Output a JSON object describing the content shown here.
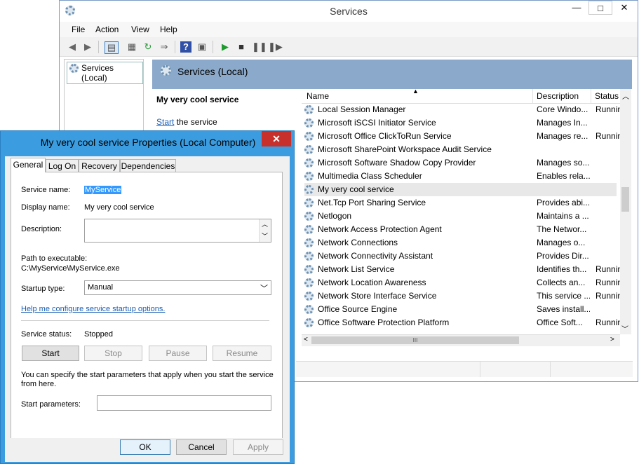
{
  "services_window": {
    "title": "Services",
    "controls": {
      "minimize": "—",
      "maximize": "□",
      "close": "✕"
    },
    "menu": [
      "File",
      "Action",
      "View",
      "Help"
    ],
    "tree_item": "Services (Local)",
    "header_title": "Services (Local)",
    "detail": {
      "service_name": "My very cool service",
      "start_link": "Start",
      "start_suffix": " the service"
    },
    "columns": {
      "name": "Name",
      "description": "Description",
      "status": "Status"
    },
    "rows": [
      {
        "name": "Local Session Manager",
        "description": "Core Windo...",
        "status": "Runnin"
      },
      {
        "name": "Microsoft iSCSI Initiator Service",
        "description": "Manages In...",
        "status": ""
      },
      {
        "name": "Microsoft Office ClickToRun Service",
        "description": "Manages re...",
        "status": "Runnin"
      },
      {
        "name": "Microsoft SharePoint Workspace Audit Service",
        "description": "",
        "status": ""
      },
      {
        "name": "Microsoft Software Shadow Copy Provider",
        "description": "Manages so...",
        "status": ""
      },
      {
        "name": "Multimedia Class Scheduler",
        "description": "Enables rela...",
        "status": ""
      },
      {
        "name": "My very cool service",
        "description": "",
        "status": ""
      },
      {
        "name": "Net.Tcp Port Sharing Service",
        "description": "Provides abi...",
        "status": ""
      },
      {
        "name": "Netlogon",
        "description": "Maintains a ...",
        "status": ""
      },
      {
        "name": "Network Access Protection Agent",
        "description": "The Networ...",
        "status": ""
      },
      {
        "name": "Network Connections",
        "description": "Manages o...",
        "status": ""
      },
      {
        "name": "Network Connectivity Assistant",
        "description": "Provides Dir...",
        "status": ""
      },
      {
        "name": "Network List Service",
        "description": "Identifies th...",
        "status": "Runnin"
      },
      {
        "name": "Network Location Awareness",
        "description": "Collects an...",
        "status": "Runnin"
      },
      {
        "name": "Network Store Interface Service",
        "description": "This service ...",
        "status": "Runnin"
      },
      {
        "name": "Office  Source Engine",
        "description": "Saves install...",
        "status": ""
      },
      {
        "name": "Office Software Protection Platform",
        "description": "Office Soft...",
        "status": "Runnin"
      }
    ],
    "hscroll_grip": "III"
  },
  "dialog": {
    "title": "My very cool service Properties (Local Computer)",
    "close": "✕",
    "tabs": [
      "General",
      "Log On",
      "Recovery",
      "Dependencies"
    ],
    "service_name_label": "Service name:",
    "service_name_value": "MyService",
    "display_name_label": "Display name:",
    "display_name_value": "My very cool service",
    "description_label": "Description:",
    "path_label": "Path to executable:",
    "path_value": "C:\\MyService\\MyService.exe",
    "startup_type_label": "Startup type:",
    "startup_type_value": "Manual",
    "help_link": "Help me configure service startup options.",
    "status_label": "Service status:",
    "status_value": "Stopped",
    "buttons": {
      "start": "Start",
      "stop": "Stop",
      "pause": "Pause",
      "resume": "Resume"
    },
    "start_params_note": "You can specify the start parameters that apply when you start the service from here.",
    "start_params_label": "Start parameters:",
    "ok": "OK",
    "cancel": "Cancel",
    "apply": "Apply"
  },
  "colors": {
    "accent": "#3b9de0",
    "header": "#8ba9ca",
    "close_red": "#c8312b",
    "link": "#1a5fb4"
  }
}
